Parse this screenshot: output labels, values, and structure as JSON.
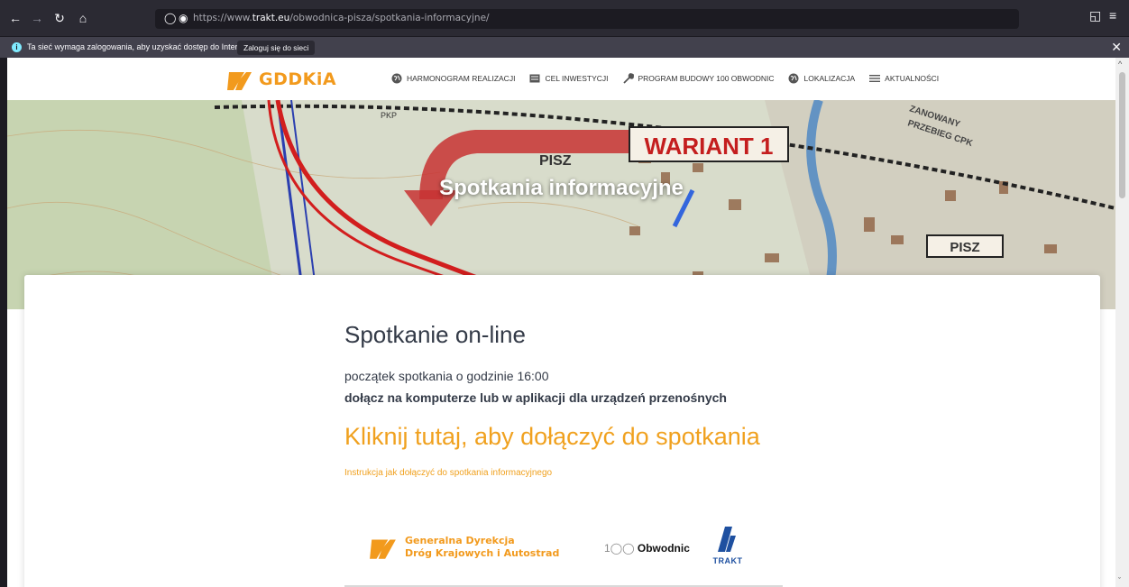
{
  "browser": {
    "url_prefix": "https://www.",
    "url_domain": "trakt.eu",
    "url_path": "/obwodnica-pisza/spotkania-informacyjne/",
    "notification": {
      "message": "Ta sieć wymaga zalogowania, aby uzyskać dostęp do Internetu.",
      "login_button": "Zaloguj się do sieci"
    }
  },
  "site": {
    "logo_text": "GDDKiA",
    "menu": [
      {
        "label": "HARMONOGRAM REALIZACJI",
        "icon": "globe-icon"
      },
      {
        "label": "CEL INWESTYCJI",
        "icon": "list-icon"
      },
      {
        "label": "PROGRAM BUDOWY 100 OBWODNIC",
        "icon": "wrench-icon"
      },
      {
        "label": "LOKALIZACJA",
        "icon": "globe-icon"
      },
      {
        "label": "AKTUALNOŚCI",
        "icon": "menu-icon"
      }
    ]
  },
  "hero": {
    "title": "Spotkania informacyjne",
    "map_labels": {
      "variant": "WARIANT 1",
      "town": "PISZ",
      "town_box": "PISZ",
      "area": "PRZEBIEG CPK",
      "area_top": "ZANOWANY",
      "rail": "PKP"
    }
  },
  "content": {
    "heading": "Spotkanie on-line",
    "start_time": "początek spotkania o godzinie 16:00",
    "join_info": "dołącz na komputerze lub w aplikacji dla urządzeń przenośnych",
    "join_link": "Kliknij tutaj, aby dołączyć do spotkania",
    "instructions_link": "Instrukcja jak dołączyć do spotkania informacyjnego",
    "partners": {
      "gddkia_line1": "Generalna Dyrekcja",
      "gddkia_line2": "Dróg Krajowych i Autostrad",
      "obwodnic_prefix": "1",
      "obwodnic_label": "Obwodnic",
      "trakt_label": "TRAKT"
    }
  },
  "colors": {
    "accent": "#f0a11f",
    "text": "#333a47",
    "chrome": "#2b2a33"
  }
}
